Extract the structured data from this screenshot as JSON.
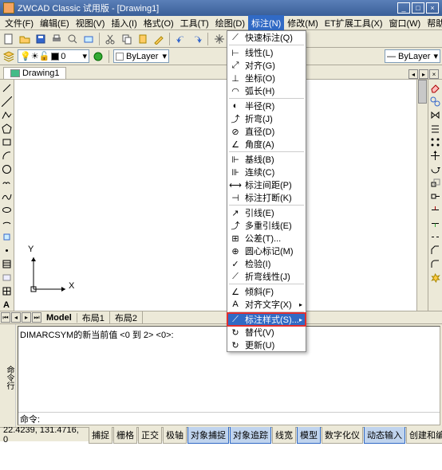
{
  "titlebar": {
    "text": "ZWCAD Classic 试用版 - [Drawing1]"
  },
  "menubar": {
    "items": [
      {
        "label": "文件(F)"
      },
      {
        "label": "编辑(E)"
      },
      {
        "label": "视图(V)"
      },
      {
        "label": "插入(I)"
      },
      {
        "label": "格式(O)"
      },
      {
        "label": "工具(T)"
      },
      {
        "label": "绘图(D)"
      },
      {
        "label": "标注(N)"
      },
      {
        "label": "修改(M)"
      },
      {
        "label": "ET扩展工具(X)"
      },
      {
        "label": "窗口(W)"
      },
      {
        "label": "帮助(H)"
      }
    ]
  },
  "toolbar2": {
    "layer": "0",
    "bylayer": "ByLayer"
  },
  "docTab": {
    "name": "Drawing1"
  },
  "dropdown": {
    "items": [
      {
        "label": "快速标注(Q)",
        "sep": false
      },
      {
        "label": "",
        "sep": true
      },
      {
        "label": "线性(L)",
        "sep": false
      },
      {
        "label": "对齐(G)",
        "sep": false
      },
      {
        "label": "坐标(O)",
        "sep": false
      },
      {
        "label": "弧长(H)",
        "sep": false
      },
      {
        "label": "",
        "sep": true
      },
      {
        "label": "半径(R)",
        "sep": false
      },
      {
        "label": "折弯(J)",
        "sep": false
      },
      {
        "label": "直径(D)",
        "sep": false
      },
      {
        "label": "角度(A)",
        "sep": false
      },
      {
        "label": "",
        "sep": true
      },
      {
        "label": "基线(B)",
        "sep": false
      },
      {
        "label": "连续(C)",
        "sep": false
      },
      {
        "label": "标注间距(P)",
        "sep": false
      },
      {
        "label": "标注打断(K)",
        "sep": false
      },
      {
        "label": "",
        "sep": true
      },
      {
        "label": "引线(E)",
        "sep": false
      },
      {
        "label": "多重引线(E)",
        "sep": false
      },
      {
        "label": "公差(T)...",
        "sep": false
      },
      {
        "label": "圆心标记(M)",
        "sep": false
      },
      {
        "label": "检验(I)",
        "sep": false
      },
      {
        "label": "折弯线性(J)",
        "sep": false
      },
      {
        "label": "",
        "sep": true
      },
      {
        "label": "倾斜(F)",
        "sep": false
      },
      {
        "label": "对齐文字(X)",
        "sep": false,
        "arrow": true
      },
      {
        "label": "",
        "sep": true
      },
      {
        "label": "标注样式(S)...",
        "sep": false,
        "hl": true,
        "arrow": true
      },
      {
        "label": "替代(V)",
        "sep": false
      },
      {
        "label": "更新(U)",
        "sep": false
      }
    ]
  },
  "modelTabs": {
    "items": [
      "Model",
      "布局1",
      "布局2"
    ]
  },
  "axis": {
    "x": "X",
    "y": "Y"
  },
  "cmd": {
    "left": "命令行",
    "hist": "DIMARCSYM的新当前值 <0 到 2> <0>:",
    "prompt": "命令:"
  },
  "status": {
    "coord": "22.4239, 131.4716, 0",
    "buttons": [
      "捕捉",
      "栅格",
      "正交",
      "极轴",
      "对象捕捉",
      "对象追踪",
      "线宽",
      "模型",
      "数字化仪",
      "动态输入",
      "创建和编"
    ]
  }
}
